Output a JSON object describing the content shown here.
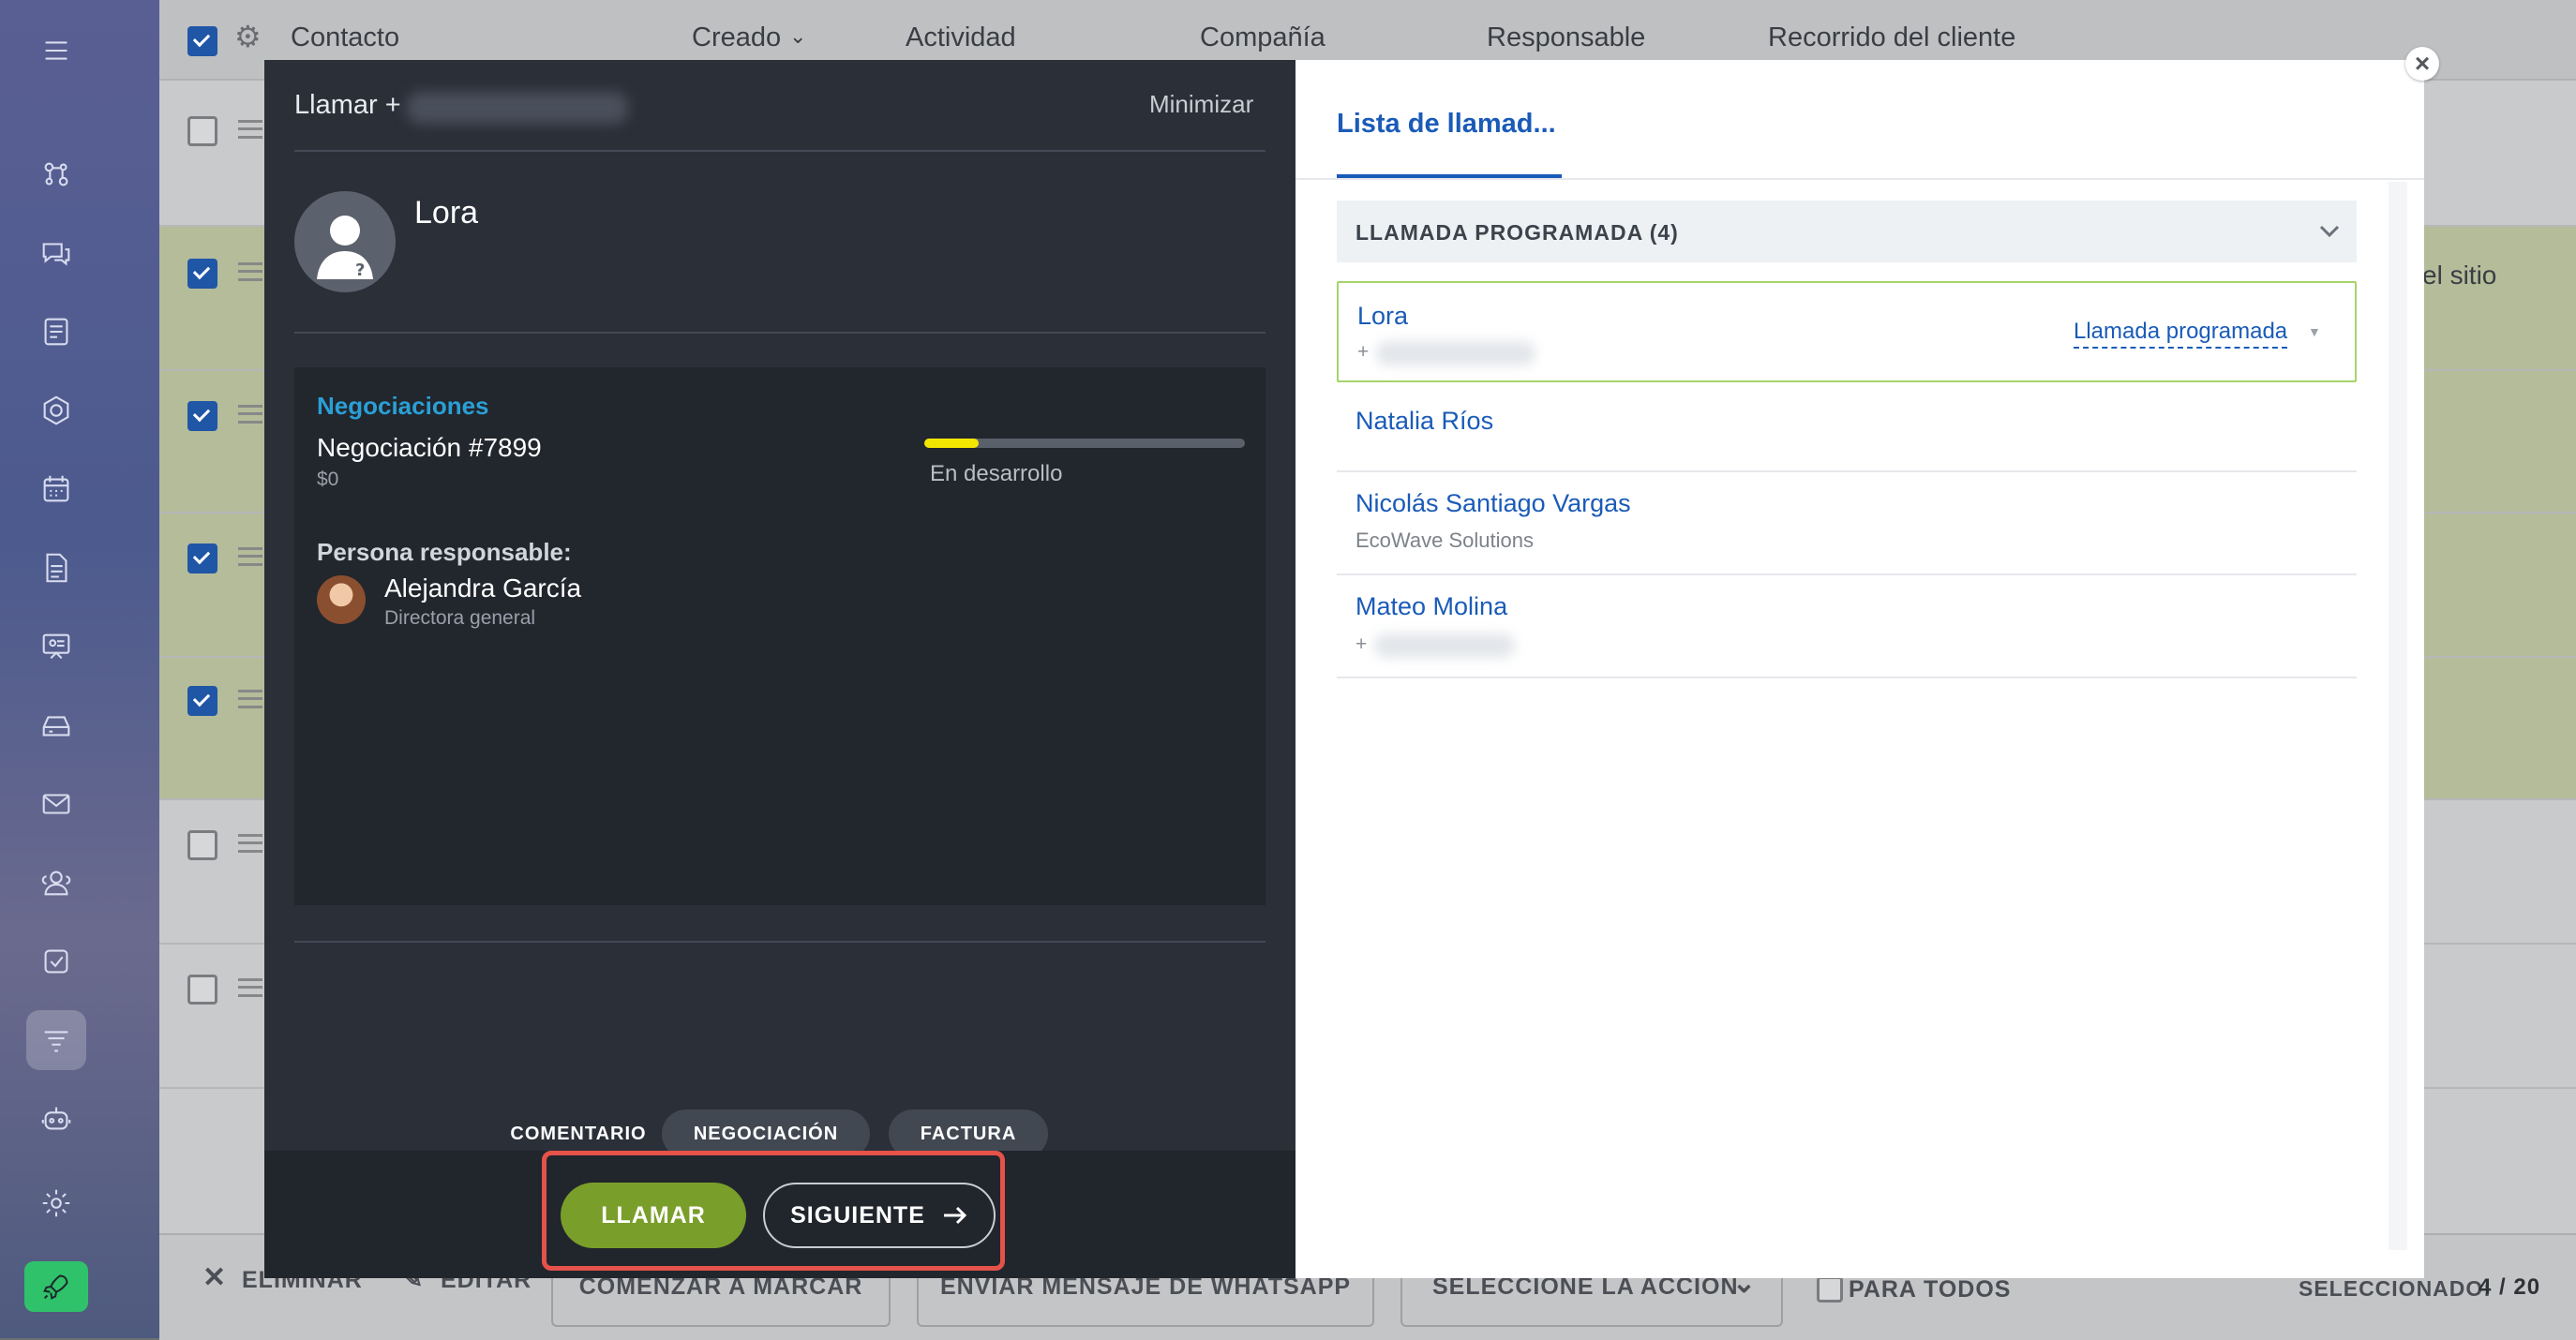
{
  "list": {
    "columns": [
      "Contacto",
      "Creado",
      "Actividad",
      "Compañía",
      "Responsable",
      "Recorrido del cliente"
    ],
    "partial_cell_text": "el sitio"
  },
  "bottom_bar": {
    "delete_label": "ELIMINAR",
    "edit_label": "EDITAR",
    "start_dialing_label": "COMENZAR A MARCAR",
    "whatsapp_label": "ENVIAR MENSAJE DE WHATSAPP",
    "select_action_label": "SELECCIONE LA ACCION",
    "for_all_label": "PARA TODOS",
    "selected_label": "SELECCIONADO:",
    "selected_count": "4 / 20"
  },
  "call_panel": {
    "title_prefix": "Llamar +",
    "minimize_label": "Minimizar",
    "contact_name": "Lora",
    "deals_heading": "Negociaciones",
    "deal_name": "Negociación #7899",
    "deal_amount": "$0",
    "deal_stage": "En desarrollo",
    "deal_progress": 0.17,
    "responsible_heading": "Persona responsable:",
    "responsible_name": "Alejandra García",
    "responsible_role": "Directora general",
    "tabs": [
      "COMENTARIO",
      "NEGOCIACIÓN",
      "FACTURA"
    ],
    "call_button": "LLAMAR",
    "next_button": "SIGUIENTE"
  },
  "call_list": {
    "tab_label": "Lista de llamad...",
    "group_label": "LLAMADA PROGRAMADA (4)",
    "items": [
      {
        "name": "Lora",
        "sub": "+",
        "status": "Llamada programada"
      },
      {
        "name": "Natalia Ríos",
        "sub": ""
      },
      {
        "name": "Nicolás Santiago Vargas",
        "sub": "EcoWave Solutions"
      },
      {
        "name": "Mateo Molina",
        "sub": "+"
      }
    ]
  },
  "colors": {
    "accent_blue": "#1a5bb8",
    "link_teal": "#2a9fd6",
    "call_green": "#7a9e2a",
    "highlight_red": "#e5524a",
    "progress_yellow": "#f2e600"
  },
  "icons": [
    "menu-icon",
    "crm-icon",
    "chat-icon",
    "feed-icon",
    "hexagon-icon",
    "calendar-icon",
    "document-icon",
    "presentation-icon",
    "drive-icon",
    "mail-icon",
    "contacts-icon",
    "tasks-icon",
    "funnel-icon",
    "robot-icon",
    "settings-icon",
    "rocket-icon"
  ]
}
